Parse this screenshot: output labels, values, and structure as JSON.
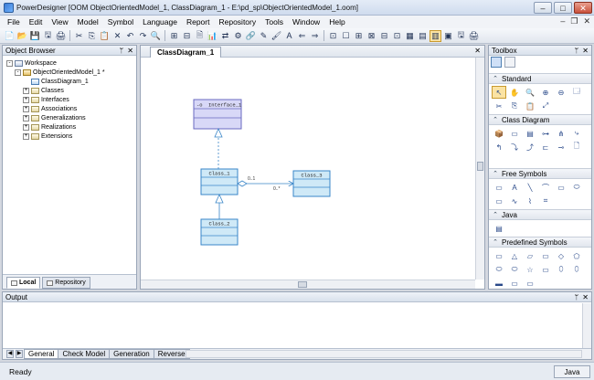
{
  "window": {
    "title": "PowerDesigner [OOM ObjectOrientedModel_1, ClassDiagram_1 - E:\\pd_sp\\ObjectOrientedModel_1.oom]",
    "minimize": "–",
    "maximize": "□",
    "close": "✕"
  },
  "menu": {
    "items": [
      "File",
      "Edit",
      "View",
      "Model",
      "Symbol",
      "Language",
      "Report",
      "Repository",
      "Tools",
      "Window",
      "Help"
    ],
    "mdi_minimize": "–",
    "mdi_restore": "❐",
    "mdi_close": "✕"
  },
  "toolbar": {
    "icons": [
      "📄",
      "📂",
      "💾",
      "🖫",
      "🖨",
      "✂",
      "⎘",
      "📋",
      "✕",
      "↶",
      "↷",
      "🔍",
      "⊞",
      "⊟",
      "🗎",
      "📊",
      "⇄",
      "⚙",
      "🔗",
      "✎",
      "🖌",
      "A",
      "⇐",
      "⇒",
      "⊡",
      "☐",
      "⊞",
      "⊠",
      "⊟",
      "⊡",
      "▦",
      "▤",
      "▥",
      "▣",
      "🖫",
      "🖨"
    ]
  },
  "object_browser": {
    "title": "Object Browser",
    "pin": "ᛘ",
    "close": "✕",
    "tree": [
      {
        "label": "Workspace",
        "icon": "ws",
        "level": 0,
        "expander": "-"
      },
      {
        "label": "ObjectOrientedModel_1 *",
        "icon": "model",
        "level": 1,
        "expander": "-"
      },
      {
        "label": "ClassDiagram_1",
        "icon": "diag",
        "level": 2,
        "expander": ""
      },
      {
        "label": "Classes",
        "icon": "folder",
        "level": 2,
        "expander": "+"
      },
      {
        "label": "Interfaces",
        "icon": "folder",
        "level": 2,
        "expander": "+"
      },
      {
        "label": "Associations",
        "icon": "folder",
        "level": 2,
        "expander": "+"
      },
      {
        "label": "Generalizations",
        "icon": "folder",
        "level": 2,
        "expander": "+"
      },
      {
        "label": "Realizations",
        "icon": "folder",
        "level": 2,
        "expander": "+"
      },
      {
        "label": "Extensions",
        "icon": "folder",
        "level": 2,
        "expander": "+"
      }
    ],
    "tabs": {
      "local": "Local",
      "repository": "Repository"
    }
  },
  "diagram": {
    "tab_label": "ClassDiagram_1",
    "tab_close": "✕",
    "interface_name": "Interface_1",
    "interface_prefix": "-o",
    "class1_name": "Class_1",
    "class2_name": "Class_2",
    "class3_name": "Class_3",
    "assoc_mult1": "0..1",
    "assoc_mult2": "0..*"
  },
  "toolbox": {
    "title": "Toolbox",
    "sections": {
      "standard": {
        "label": "Standard",
        "tools": [
          "↖",
          "✋",
          "🔍",
          "⊕",
          "⊖",
          "🗔",
          "✂",
          "⎘",
          "📋",
          "⤢"
        ]
      },
      "class_diagram": {
        "label": "Class Diagram",
        "tools": [
          "📦",
          "▭",
          "▤",
          "⊶",
          "⋔",
          "⤷",
          "↰",
          "⤵",
          "⤴",
          "⊏",
          "⊸",
          "🗋"
        ]
      },
      "free_symbols": {
        "label": "Free Symbols",
        "tools": [
          "▭",
          "A",
          "╲",
          "⌒",
          "▭",
          "⬭",
          "▭",
          "∿",
          "⌇",
          "⌗"
        ]
      },
      "java": {
        "label": "Java",
        "tools": [
          "▤"
        ]
      },
      "predefined_symbols": {
        "label": "Predefined Symbols",
        "tools": [
          "▭",
          "△",
          "▱",
          "▭",
          "◇",
          "⬠",
          "⬭",
          "⬭",
          "☆",
          "▭",
          "⬯",
          "⬯",
          "▬",
          "▭",
          "▭"
        ]
      }
    }
  },
  "output": {
    "title": "Output",
    "tabs": [
      "General",
      "Check Model",
      "Generation",
      "Reverse"
    ]
  },
  "status": {
    "text": "Ready",
    "language": "Java"
  },
  "colors": {
    "class_fill": "#cfe9f7",
    "class_stroke": "#3a86c8",
    "interface_fill": "#d8d8f7",
    "interface_stroke": "#6a6ac0"
  }
}
